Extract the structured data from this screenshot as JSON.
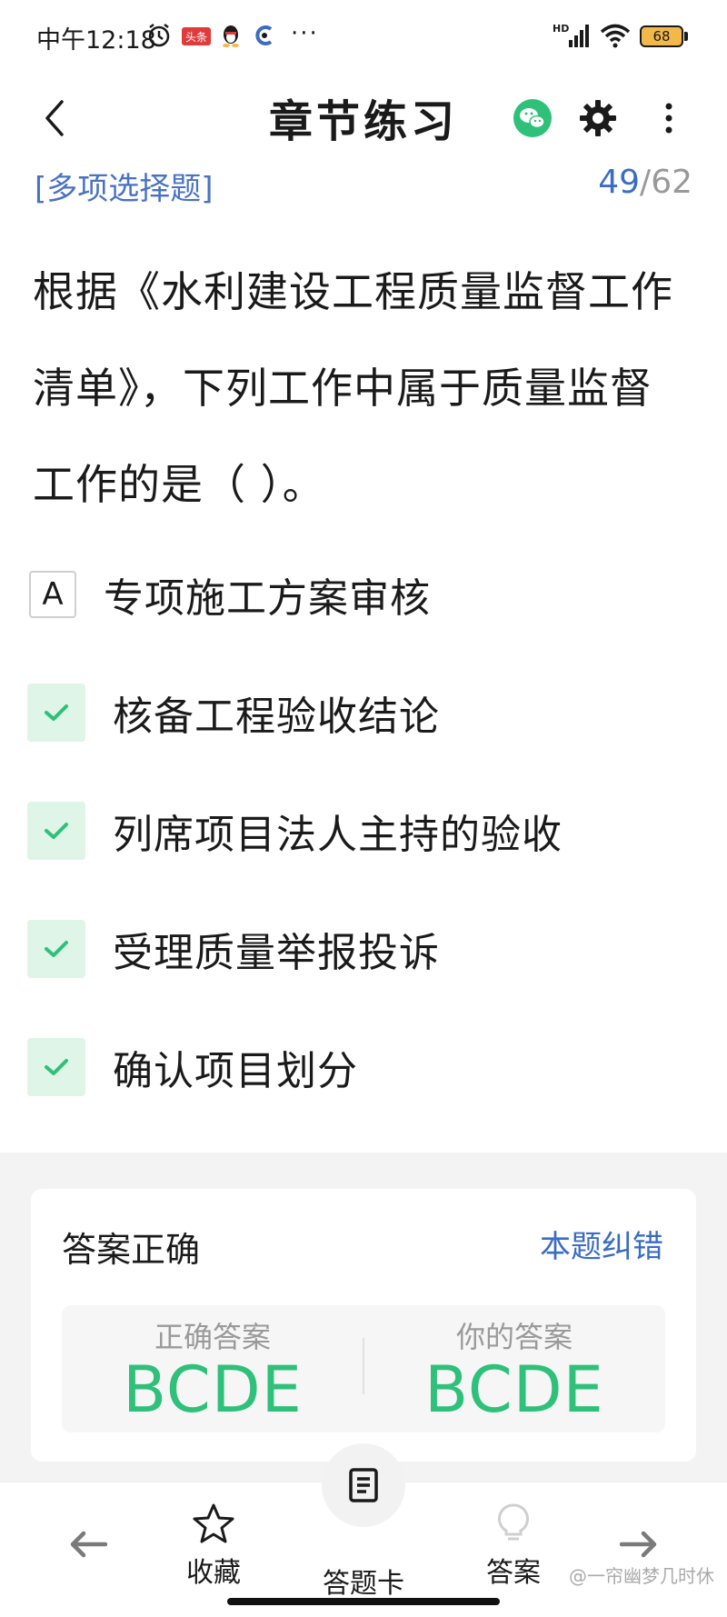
{
  "status_bar": {
    "time": "中午12:18",
    "news_badge": "头条",
    "overflow": "···",
    "signal_label": "HD",
    "battery": "68"
  },
  "header": {
    "title": "章节练习",
    "icons": [
      "back-arrow-icon",
      "wechat-icon",
      "gear-icon",
      "more-vertical-icon"
    ]
  },
  "question": {
    "type_label": "[多项选择题]",
    "current": "49",
    "separator": "/",
    "total": "62",
    "text": "根据《水利建设工程质量监督工作清单》，下列工作中属于质量监督工作的是（ ）。"
  },
  "options": [
    {
      "marker": "A",
      "text": "专项施工方案审核",
      "selected": false
    },
    {
      "marker": "check",
      "text": "核备工程验收结论",
      "selected": true
    },
    {
      "marker": "check",
      "text": "列席项目法人主持的验收",
      "selected": true
    },
    {
      "marker": "check",
      "text": "受理质量举报投诉",
      "selected": true
    },
    {
      "marker": "check",
      "text": "确认项目划分",
      "selected": true
    }
  ],
  "result": {
    "status": "答案正确",
    "report_link": "本题纠错",
    "correct_label": "正确答案",
    "correct_value": "BCDE",
    "yours_label": "你的答案",
    "yours_value": "BCDE"
  },
  "toolbar": {
    "favorite": "收藏",
    "answer_card": "答题卡",
    "answer": "答案"
  },
  "watermark": "@一帘幽梦几时休",
  "colors": {
    "accent_blue": "#3b6cc4",
    "correct_green": "#2fc07a",
    "check_bg": "#dff5e7"
  }
}
